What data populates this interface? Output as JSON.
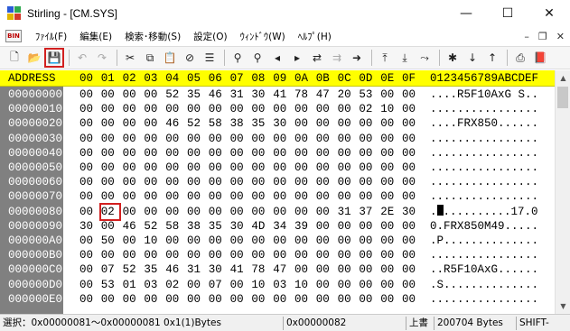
{
  "window": {
    "title": "Stirling - [CM.SYS]",
    "minimize_glyph": "—",
    "maximize_glyph": "☐",
    "close_glyph": "✕"
  },
  "menubar": {
    "icon_text": "BIN",
    "items": [
      {
        "label": "ﾌｧｲﾙ(F)"
      },
      {
        "label": "編集(E)"
      },
      {
        "label": "検索･移動(S)"
      },
      {
        "label": "設定(O)"
      },
      {
        "label": "ｳｨﾝﾄﾞｳ(W)"
      },
      {
        "label": "ﾍﾙﾌﾟ(H)"
      }
    ],
    "mdi": {
      "minimize": "–",
      "restore": "❐",
      "close": "✕"
    }
  },
  "toolbar": {
    "buttons": [
      {
        "name": "new-file",
        "glyph": "🗋",
        "state": "normal"
      },
      {
        "name": "open-file",
        "glyph": "📂",
        "state": "normal"
      },
      {
        "name": "save",
        "glyph": "💾",
        "state": "selected"
      },
      {
        "sep": true
      },
      {
        "name": "undo",
        "glyph": "↶",
        "state": "disabled"
      },
      {
        "name": "redo",
        "glyph": "↷",
        "state": "disabled"
      },
      {
        "sep": true
      },
      {
        "name": "cut",
        "glyph": "✂",
        "state": "normal"
      },
      {
        "name": "copy",
        "glyph": "⧉",
        "state": "normal"
      },
      {
        "name": "paste",
        "glyph": "📋",
        "state": "normal"
      },
      {
        "name": "delete",
        "glyph": "⊘",
        "state": "normal"
      },
      {
        "name": "fill",
        "glyph": "☰",
        "state": "normal"
      },
      {
        "sep": true
      },
      {
        "name": "find",
        "glyph": "⚲",
        "state": "normal"
      },
      {
        "name": "find-hex",
        "glyph": "⚲",
        "state": "normal"
      },
      {
        "name": "find-prev",
        "glyph": "◂",
        "state": "normal"
      },
      {
        "name": "find-next",
        "glyph": "▸",
        "state": "normal"
      },
      {
        "name": "replace",
        "glyph": "⇄",
        "state": "normal"
      },
      {
        "name": "replace-all",
        "glyph": "⇉",
        "state": "disabled"
      },
      {
        "name": "jump",
        "glyph": "➜",
        "state": "normal"
      },
      {
        "sep": true
      },
      {
        "name": "page-top",
        "glyph": "⤒",
        "state": "normal"
      },
      {
        "name": "page-down",
        "glyph": "⤓",
        "state": "normal"
      },
      {
        "name": "page-jump",
        "glyph": "⤳",
        "state": "normal"
      },
      {
        "sep": true
      },
      {
        "name": "mark",
        "glyph": "✱",
        "state": "normal"
      },
      {
        "name": "mark-prev",
        "glyph": "↓",
        "state": "normal"
      },
      {
        "name": "mark-next",
        "glyph": "↑",
        "state": "normal"
      },
      {
        "sep": true
      },
      {
        "name": "print",
        "glyph": "⎙",
        "state": "normal"
      },
      {
        "name": "help",
        "glyph": "📕",
        "state": "normal"
      }
    ]
  },
  "hex": {
    "header_addr": "ADDRESS",
    "header_cols": [
      "00",
      "01",
      "02",
      "03",
      "04",
      "05",
      "06",
      "07",
      "08",
      "09",
      "0A",
      "0B",
      "0C",
      "0D",
      "0E",
      "0F"
    ],
    "header_ascii": "0123456789ABCDEF",
    "rows": [
      {
        "addr": "00000000",
        "bytes": [
          "00",
          "00",
          "00",
          "00",
          "52",
          "35",
          "46",
          "31",
          "30",
          "41",
          "78",
          "47",
          "20",
          "53",
          "00",
          "00"
        ],
        "ascii": "....R5F10AxG S.."
      },
      {
        "addr": "00000010",
        "bytes": [
          "00",
          "00",
          "00",
          "00",
          "00",
          "00",
          "00",
          "00",
          "00",
          "00",
          "00",
          "00",
          "00",
          "02",
          "10",
          "00"
        ],
        "ascii": "................"
      },
      {
        "addr": "00000020",
        "bytes": [
          "00",
          "00",
          "00",
          "00",
          "46",
          "52",
          "58",
          "38",
          "35",
          "30",
          "00",
          "00",
          "00",
          "00",
          "00",
          "00"
        ],
        "ascii": "....FRX850......"
      },
      {
        "addr": "00000030",
        "bytes": [
          "00",
          "00",
          "00",
          "00",
          "00",
          "00",
          "00",
          "00",
          "00",
          "00",
          "00",
          "00",
          "00",
          "00",
          "00",
          "00"
        ],
        "ascii": "................"
      },
      {
        "addr": "00000040",
        "bytes": [
          "00",
          "00",
          "00",
          "00",
          "00",
          "00",
          "00",
          "00",
          "00",
          "00",
          "00",
          "00",
          "00",
          "00",
          "00",
          "00"
        ],
        "ascii": "................"
      },
      {
        "addr": "00000050",
        "bytes": [
          "00",
          "00",
          "00",
          "00",
          "00",
          "00",
          "00",
          "00",
          "00",
          "00",
          "00",
          "00",
          "00",
          "00",
          "00",
          "00"
        ],
        "ascii": "................"
      },
      {
        "addr": "00000060",
        "bytes": [
          "00",
          "00",
          "00",
          "00",
          "00",
          "00",
          "00",
          "00",
          "00",
          "00",
          "00",
          "00",
          "00",
          "00",
          "00",
          "00"
        ],
        "ascii": "................"
      },
      {
        "addr": "00000070",
        "bytes": [
          "00",
          "00",
          "00",
          "00",
          "00",
          "00",
          "00",
          "00",
          "00",
          "00",
          "00",
          "00",
          "00",
          "00",
          "00",
          "00"
        ],
        "ascii": "................"
      },
      {
        "addr": "00000080",
        "bytes": [
          "00",
          "02",
          "00",
          "00",
          "00",
          "00",
          "00",
          "00",
          "00",
          "00",
          "00",
          "00",
          "31",
          "37",
          "2E",
          "30"
        ],
        "ascii_pre": ".",
        "ascii_post": "..........17.0"
      },
      {
        "addr": "00000090",
        "bytes": [
          "30",
          "00",
          "46",
          "52",
          "58",
          "38",
          "35",
          "30",
          "4D",
          "34",
          "39",
          "00",
          "00",
          "00",
          "00",
          "00"
        ],
        "ascii": "0.FRX850M49....."
      },
      {
        "addr": "000000A0",
        "bytes": [
          "00",
          "50",
          "00",
          "10",
          "00",
          "00",
          "00",
          "00",
          "00",
          "00",
          "00",
          "00",
          "00",
          "00",
          "00",
          "00"
        ],
        "ascii": ".P.............."
      },
      {
        "addr": "000000B0",
        "bytes": [
          "00",
          "00",
          "00",
          "00",
          "00",
          "00",
          "00",
          "00",
          "00",
          "00",
          "00",
          "00",
          "00",
          "00",
          "00",
          "00"
        ],
        "ascii": "................"
      },
      {
        "addr": "000000C0",
        "bytes": [
          "00",
          "07",
          "52",
          "35",
          "46",
          "31",
          "30",
          "41",
          "78",
          "47",
          "00",
          "00",
          "00",
          "00",
          "00",
          "00"
        ],
        "ascii": "..R5F10AxG......"
      },
      {
        "addr": "000000D0",
        "bytes": [
          "00",
          "53",
          "01",
          "03",
          "02",
          "00",
          "07",
          "00",
          "10",
          "03",
          "10",
          "00",
          "00",
          "00",
          "00",
          "00"
        ],
        "ascii": ".S.............."
      },
      {
        "addr": "000000E0",
        "bytes": [
          "00",
          "00",
          "00",
          "00",
          "00",
          "00",
          "00",
          "00",
          "00",
          "00",
          "00",
          "00",
          "00",
          "00",
          "00",
          "00"
        ],
        "ascii": "................"
      }
    ],
    "selected_offset": "00000081"
  },
  "statusbar": {
    "selection": "選択：0x00000081〜0x00000081 0x1(1)Bytes",
    "cursor": "0x00000082",
    "mode": "上書",
    "size": "200704 Bytes",
    "shift": "SHIFT-"
  },
  "colors": {
    "header_bg": "#ffff00",
    "gutter_bg": "#808080",
    "selection_outline": "#d21f1f"
  }
}
